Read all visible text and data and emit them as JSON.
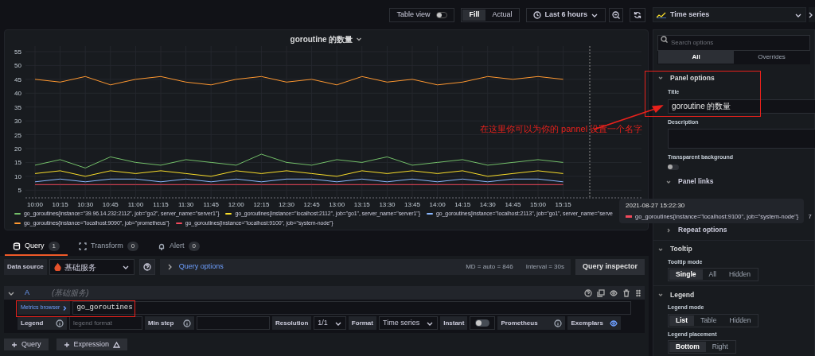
{
  "toolbar": {
    "table_view": {
      "label": "Table view",
      "on": false
    },
    "fill_modes": [
      {
        "label": "Fill",
        "selected": true
      },
      {
        "label": "Actual",
        "selected": false
      }
    ],
    "time_range": "Last 6 hours"
  },
  "panel": {
    "title": "goroutine 的数量",
    "chart_data": {
      "type": "line",
      "grid": true,
      "categories": [
        "10:00",
        "10:15",
        "10:30",
        "10:45",
        "11:00",
        "11:15",
        "11:30",
        "11:45",
        "12:00",
        "12:15",
        "12:30",
        "12:45",
        "13:00",
        "13:15",
        "13:30",
        "13:45",
        "14:00",
        "14:15",
        "14:30",
        "14:45",
        "15:00",
        "15:15"
      ],
      "yticks": [
        5,
        10,
        15,
        20,
        25,
        30,
        35,
        40,
        45,
        50,
        55
      ],
      "ylim": [
        2.5,
        57
      ],
      "series": [
        {
          "name": "go_goroutines{instance=\"39.96.14.232:2112\", job=\"go2\", server_name=\"server1\"}",
          "color": "#73bf69",
          "values": [
            14,
            16,
            13,
            17,
            15,
            14,
            16,
            15,
            14,
            18,
            15,
            14,
            16,
            15,
            17,
            14,
            15,
            16,
            14,
            15,
            16,
            15
          ]
        },
        {
          "name": "go_goroutines{instance=\"localhost:2112\", job=\"go1\", server_name=\"server1\"}",
          "color": "#fade2a",
          "values": [
            11,
            12,
            10,
            12,
            11,
            12,
            11,
            10,
            12,
            11,
            12,
            11,
            10,
            12,
            11,
            12,
            11,
            12,
            10,
            11,
            12,
            11
          ]
        },
        {
          "name": "go_goroutines{instance=\"localhost:2113\", job=\"go1\", server_name=\"serve",
          "color": "#8ab8ff",
          "values": [
            8,
            9,
            8,
            9,
            9,
            8,
            9,
            8,
            9,
            8,
            9,
            9,
            8,
            9,
            8,
            9,
            8,
            9,
            8,
            9,
            9,
            8
          ]
        },
        {
          "name": "go_goroutines{instance=\"localhost:9090\", job=\"prometheus\"}",
          "color": "#ff9830",
          "values": [
            45,
            44,
            46,
            43,
            45,
            46,
            44,
            43,
            45,
            46,
            44,
            45,
            43,
            46,
            44,
            45,
            43,
            44,
            46,
            45,
            46,
            45
          ]
        },
        {
          "name": "go_goroutines{instance=\"localhost:9100\", job=\"system-node\"}",
          "color": "#f2495c",
          "values": [
            7,
            7,
            7,
            7,
            7,
            7,
            7,
            7,
            7,
            7,
            7,
            7,
            7,
            7,
            7,
            7,
            7,
            7,
            7,
            7,
            7,
            7
          ]
        }
      ]
    },
    "tooltip": {
      "time": "2021-08-27 15:22:30",
      "series": "go_goroutines{instance=\"localhost:9100\", job=\"system-node\"}",
      "value": "7",
      "color": "#f2495c"
    }
  },
  "annotation": {
    "text": "在这里你可以为你的 pannel 设置一个名字"
  },
  "query_tabs": [
    {
      "label": "Query",
      "count": "1",
      "selected": true
    },
    {
      "label": "Transform",
      "count": "0",
      "selected": false
    },
    {
      "label": "Alert",
      "count": "0",
      "selected": false
    }
  ],
  "data_source": {
    "label": "Data source",
    "value": "基础服务"
  },
  "query_options": {
    "label": "Query options",
    "md": "MD = auto = 846",
    "interval": "Interval = 30s",
    "inspector": "Query inspector"
  },
  "query": {
    "ref": "A",
    "datasource": "(基础服务)",
    "metrics_browser": "Metrics browser",
    "expr": "go_goroutines",
    "fields": [
      {
        "kind": "input",
        "label": "Legend",
        "placeholder": "legend format"
      },
      {
        "kind": "input",
        "label": "Min step"
      },
      {
        "kind": "select",
        "label": "Resolution",
        "value": "1/1"
      },
      {
        "kind": "select",
        "label": "Format",
        "value": "Time series"
      },
      {
        "kind": "switch",
        "label": "Instant",
        "on": false
      },
      {
        "kind": "info",
        "label": "Prometheus"
      },
      {
        "kind": "eye",
        "label": "Exemplars"
      }
    ]
  },
  "add_buttons": [
    {
      "label": "Query"
    },
    {
      "label": "Expression"
    }
  ],
  "options": {
    "visualization": "Time series",
    "search_placeholder": "Search options",
    "tabs": [
      {
        "label": "All",
        "selected": true
      },
      {
        "label": "Overrides",
        "selected": false
      }
    ],
    "sections": [
      {
        "title": "Panel options",
        "items": [
          {
            "kind": "text",
            "label": "Title",
            "value": "goroutine 的数量"
          },
          {
            "kind": "textarea",
            "label": "Description"
          },
          {
            "kind": "switch",
            "label": "Transparent background",
            "on": false
          },
          {
            "kind": "group",
            "label": "Panel links",
            "expanded": true
          },
          {
            "kind": "group",
            "label": "Repeat options",
            "expanded": false
          }
        ]
      },
      {
        "title": "Tooltip",
        "items": [
          {
            "kind": "radio",
            "label": "Tooltip mode",
            "options": [
              {
                "label": "Single",
                "selected": true
              },
              {
                "label": "All",
                "selected": false
              },
              {
                "label": "Hidden",
                "selected": false
              }
            ]
          }
        ]
      },
      {
        "title": "Legend",
        "items": [
          {
            "kind": "radio",
            "label": "Legend mode",
            "options": [
              {
                "label": "List",
                "selected": true
              },
              {
                "label": "Table",
                "selected": false
              },
              {
                "label": "Hidden",
                "selected": false
              }
            ]
          },
          {
            "kind": "radio",
            "label": "Legend placement",
            "options": [
              {
                "label": "Bottom",
                "selected": true
              },
              {
                "label": "Right",
                "selected": false
              }
            ]
          }
        ]
      }
    ]
  }
}
